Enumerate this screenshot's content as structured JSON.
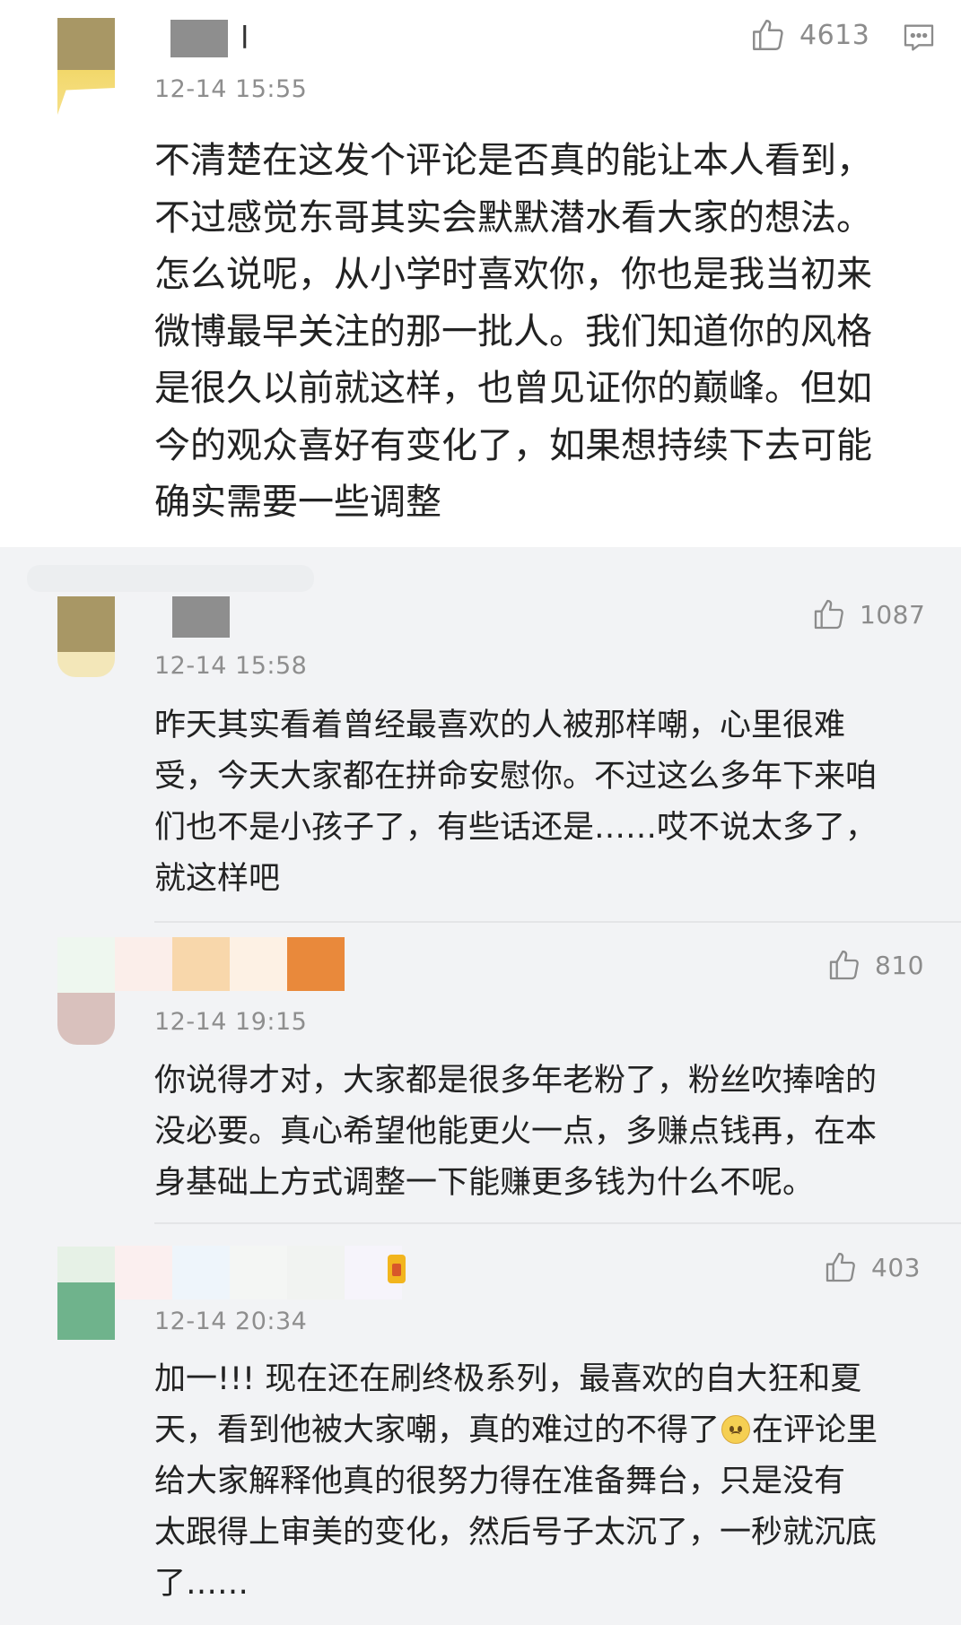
{
  "comments": [
    {
      "time": "12-14 15:55",
      "likes": "4613",
      "text": "不清楚在这发个评论是否真的能让本人看到，\n不过感觉东哥其实会默默潜水看大家的想法。\n怎么说呢，从小学时喜欢你，你也是我当初来\n微博最早关注的那一批人。我们知道你的风格\n是很久以前就这样，也曾见证你的巅峰。但如\n今的观众喜好有变化了，如果想持续下去可能\n确实需要一些调整",
      "name_tail": "l"
    },
    {
      "time": "12-14 15:58",
      "likes": "1087",
      "text": "昨天其实看着曾经最喜欢的人被那样嘲，心里很难\n受，今天大家都在拼命安慰你。不过这么多年下来咱\n们也不是小孩子了，有些话还是……哎不说太多了，\n就这样吧"
    },
    {
      "time": "12-14 19:15",
      "likes": "810",
      "text": "你说得才对，大家都是很多年老粉了，粉丝吹捧啥的\n没必要。真心希望他能更火一点，多赚点钱再，在本\n身基础上方式调整一下能赚更多钱为什么不呢。"
    },
    {
      "time": "12-14 20:34",
      "likes": "403",
      "text_before_emoji": "加一!!! 现在还在刷终极系列，最喜欢的自大狂和夏\n天，看到他被大家嘲，真的难过的不得了",
      "text_after_emoji": "在评论里\n给大家解释他真的很努力得在准备舞台，只是没有\n太跟得上审美的变化，然后号子太沉了，一秒就沉底\n了……"
    }
  ],
  "icons": {
    "like": "thumbs-up-icon",
    "reply": "comment-icon",
    "emoji": "worried-face-emoji"
  },
  "colors": {
    "accent_orange": "#e9893b",
    "muted_text": "#8e8e8e",
    "card_bg": "#ffffff",
    "feed_bg": "#f2f3f5"
  }
}
